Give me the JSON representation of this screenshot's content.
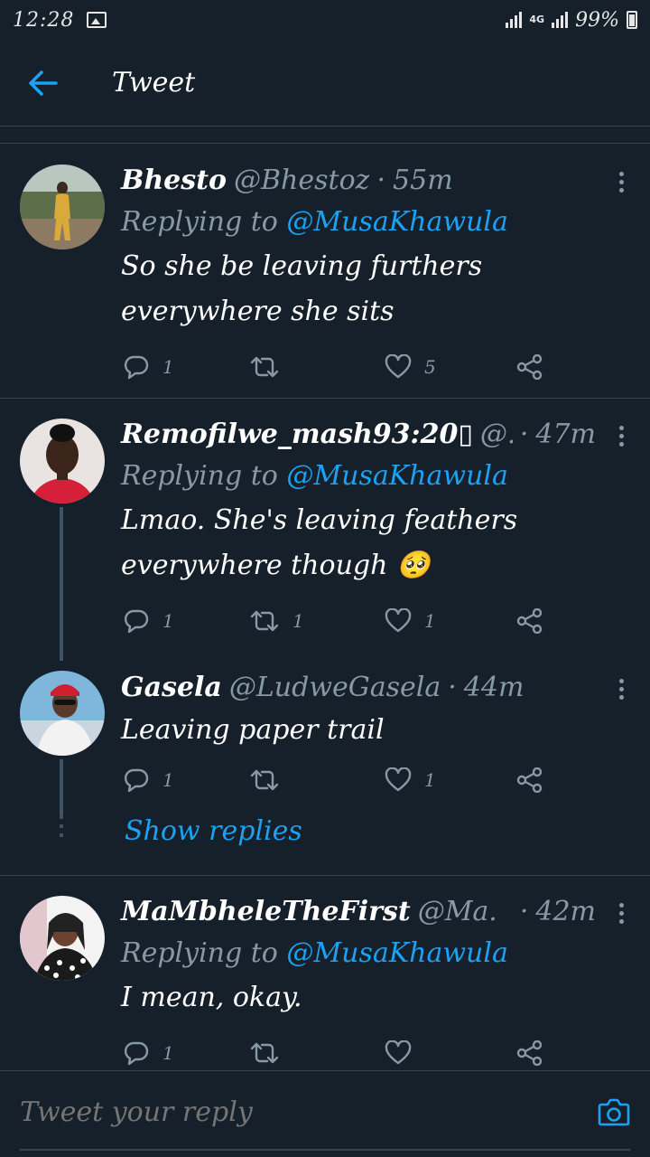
{
  "status_bar": {
    "time": "12:28",
    "network": "4G",
    "battery": "99%"
  },
  "header": {
    "title": "Tweet"
  },
  "tweets": [
    {
      "name": "Bhesto",
      "handle": "@Bhestoz",
      "dot": "·",
      "ago": "55m",
      "replying_prefix": "Replying to ",
      "replying_to": "@MusaKhawula",
      "text_line1": "So she be leaving furthers",
      "text_line2": "everywhere she sits",
      "replies": "1",
      "retweets": "",
      "likes": "5"
    },
    {
      "name": "Remofilwe_mash93:20▯",
      "handle": "@...",
      "dot": "·",
      "ago": "47m",
      "replying_prefix": "Replying to ",
      "replying_to": "@MusaKhawula",
      "text_line1": "Lmao. She's leaving feathers",
      "text_line2": "everywhere though",
      "emoji": "🥺",
      "replies": "1",
      "retweets": "1",
      "likes": "1"
    },
    {
      "name": "Gasela",
      "handle": "@LudweGasela",
      "dot": "·",
      "ago": "44m",
      "text_line1": "Leaving paper trail",
      "replies": "1",
      "retweets": "",
      "likes": "1"
    },
    {
      "name": "MaMbheleTheFirst",
      "handle": "@Ma...",
      "dot": "·",
      "ago": "42m",
      "replying_prefix": "Replying to ",
      "replying_to": "@MusaKhawula",
      "text_line1": "I mean, okay.",
      "replies": "1",
      "retweets": "",
      "likes": ""
    }
  ],
  "show_replies": "Show replies",
  "reply_bar": {
    "placeholder": "Tweet your reply"
  },
  "colors": {
    "background": "#15202b",
    "accent": "#1da1f2",
    "muted": "#8899a6",
    "divider": "#38444d"
  }
}
